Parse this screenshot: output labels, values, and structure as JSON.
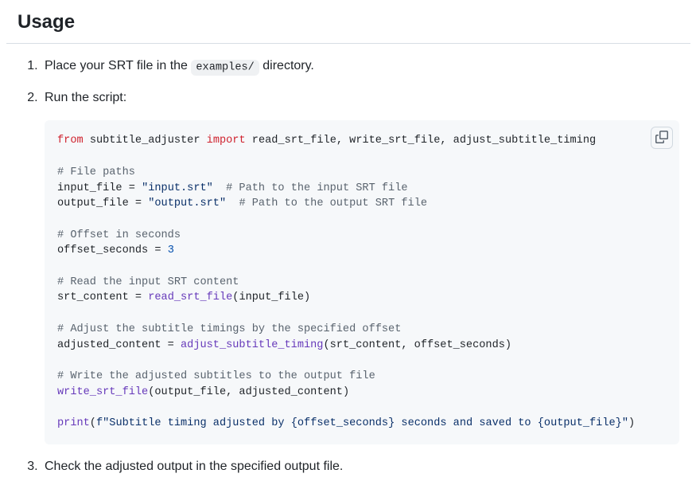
{
  "heading": "Usage",
  "steps": {
    "s1_pre": "Place your SRT file in the ",
    "s1_code": "examples/",
    "s1_post": " directory.",
    "s2": "Run the script:",
    "s3": "Check the adjusted output in the specified output file."
  },
  "code": {
    "l1": {
      "from": "from",
      "mod": "subtitle_adjuster",
      "import": "import",
      "names": "read_srt_file, write_srt_file, adjust_subtitle_timing"
    },
    "c1": "# File paths",
    "l2": {
      "var": "input_file = ",
      "str": "\"input.srt\"",
      "com": "  # Path to the input SRT file"
    },
    "l3": {
      "var": "output_file = ",
      "str": "\"output.srt\"",
      "com": "  # Path to the output SRT file"
    },
    "c2": "# Offset in seconds",
    "l4": {
      "var": "offset_seconds = ",
      "num": "3"
    },
    "c3": "# Read the input SRT content",
    "l5": {
      "var": "srt_content = ",
      "fn": "read_srt_file",
      "args": "(input_file)"
    },
    "c4": "# Adjust the subtitle timings by the specified offset",
    "l6": {
      "var": "adjusted_content = ",
      "fn": "adjust_subtitle_timing",
      "args": "(srt_content, offset_seconds)"
    },
    "c5": "# Write the adjusted subtitles to the output file",
    "l7": {
      "fn": "write_srt_file",
      "args": "(output_file, adjusted_content)"
    },
    "l8": {
      "fn": "print",
      "open": "(",
      "fpre": "f\"Subtitle timing adjusted by ",
      "b1o": "{",
      "b1v": "offset_seconds",
      "b1c": "}",
      "mid": " seconds and saved to ",
      "b2o": "{",
      "b2v": "output_file",
      "b2c": "}",
      "fend": "\"",
      "close": ")"
    }
  }
}
